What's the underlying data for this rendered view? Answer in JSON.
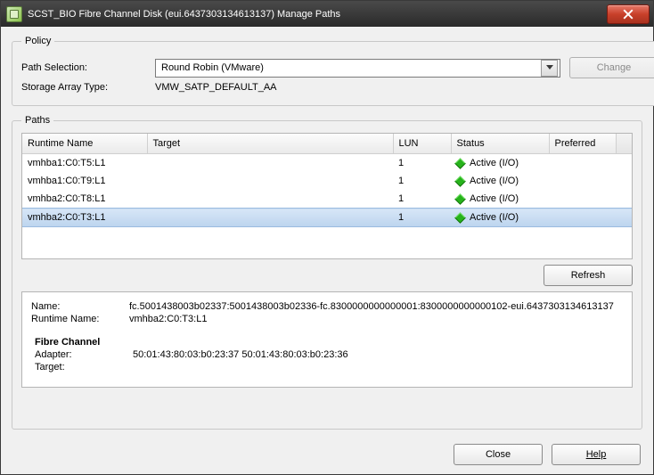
{
  "window": {
    "title": "SCST_BIO Fibre Channel Disk (eui.6437303134613137) Manage Paths"
  },
  "policy": {
    "legend": "Policy",
    "path_selection_label": "Path Selection:",
    "path_selection_value": "Round Robin (VMware)",
    "change_label": "Change",
    "storage_array_type_label": "Storage Array Type:",
    "storage_array_type_value": "VMW_SATP_DEFAULT_AA"
  },
  "paths": {
    "legend": "Paths",
    "columns": {
      "runtime_name": "Runtime Name",
      "target": "Target",
      "lun": "LUN",
      "status": "Status",
      "preferred": "Preferred"
    },
    "rows": [
      {
        "runtime_name": "vmhba1:C0:T5:L1",
        "target": "",
        "lun": "1",
        "status": "Active (I/O)",
        "preferred": "",
        "selected": false
      },
      {
        "runtime_name": "vmhba1:C0:T9:L1",
        "target": "",
        "lun": "1",
        "status": "Active (I/O)",
        "preferred": "",
        "selected": false
      },
      {
        "runtime_name": "vmhba2:C0:T8:L1",
        "target": "",
        "lun": "1",
        "status": "Active (I/O)",
        "preferred": "",
        "selected": false
      },
      {
        "runtime_name": "vmhba2:C0:T3:L1",
        "target": "",
        "lun": "1",
        "status": "Active (I/O)",
        "preferred": "",
        "selected": true
      }
    ],
    "refresh_label": "Refresh",
    "details": {
      "name_label": "Name:",
      "name_value": "fc.5001438003b02337:5001438003b02336-fc.8300000000000001:8300000000000102-eui.6437303134613137",
      "runtime_name_label": "Runtime Name:",
      "runtime_name_value": "vmhba2:C0:T3:L1",
      "section_title": "Fibre Channel",
      "adapter_label": "Adapter:",
      "adapter_value": "50:01:43:80:03:b0:23:37 50:01:43:80:03:b0:23:36",
      "target_label": "Target:",
      "target_value": ""
    }
  },
  "footer": {
    "close_label": "Close",
    "help_label": "Help"
  }
}
